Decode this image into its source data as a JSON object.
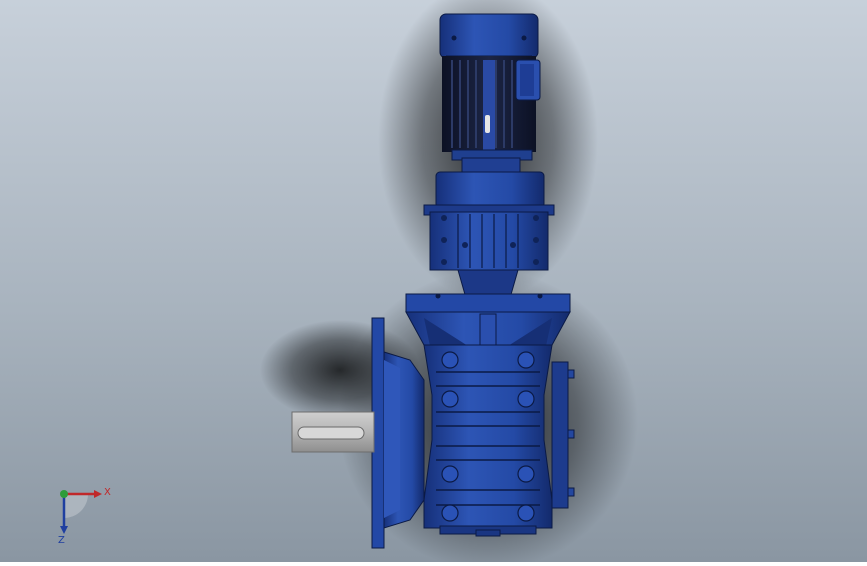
{
  "colors": {
    "background_top": "#c6cfd8",
    "background_bottom": "#8c98a4",
    "body_blue": "#1f3f8f",
    "body_blue_light": "#3a63c4",
    "body_blue_dark": "#0f2358",
    "motor_dark": "#141a2e",
    "shaft_grey": "#b9b9b9",
    "axis_x": "#c0282a",
    "axis_y": "#2e9c3a",
    "axis_z": "#1f3fa0"
  },
  "triad": {
    "x_label": "X",
    "z_label": "Z"
  }
}
